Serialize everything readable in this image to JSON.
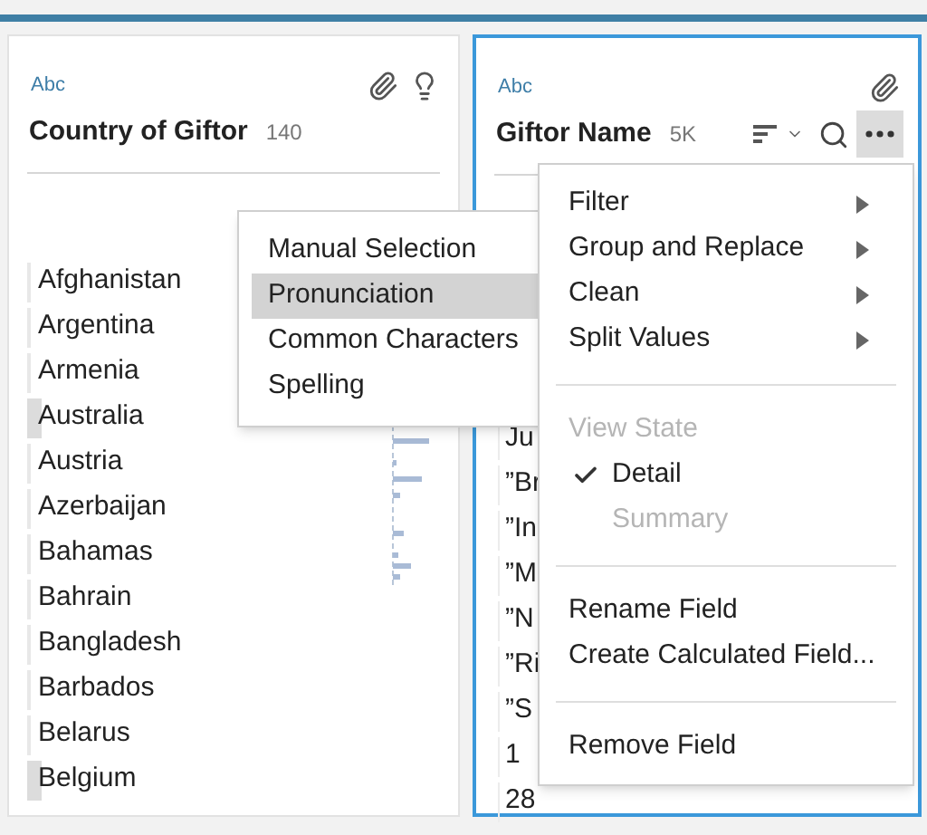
{
  "cards": [
    {
      "type_label": "Abc",
      "title": "Country of Giftor",
      "count": "140",
      "focused": false,
      "tools": false,
      "rows": [
        {
          "label": "Afghanistan",
          "highlighted": false
        },
        {
          "label": "Argentina",
          "highlighted": false
        },
        {
          "label": "Armenia",
          "highlighted": false
        },
        {
          "label": "Australia",
          "highlighted": true
        },
        {
          "label": "Austria",
          "highlighted": false
        },
        {
          "label": "Azerbaijan",
          "highlighted": false
        },
        {
          "label": "Bahamas",
          "highlighted": false
        },
        {
          "label": "Bahrain",
          "highlighted": false
        },
        {
          "label": "Bangladesh",
          "highlighted": false
        },
        {
          "label": "Barbados",
          "highlighted": false
        },
        {
          "label": "Belarus",
          "highlighted": false
        },
        {
          "label": "Belgium",
          "highlighted": true
        }
      ]
    },
    {
      "type_label": "Abc",
      "title": "Giftor Name",
      "count": "5K",
      "focused": true,
      "tools": true,
      "rows": [
        {
          "label": "Ju"
        },
        {
          "label": "”Br"
        },
        {
          "label": "”In"
        },
        {
          "label": "”M"
        },
        {
          "label": "”N"
        },
        {
          "label": "”Ri"
        },
        {
          "label": "”S"
        },
        {
          "label": "1"
        },
        {
          "label": "28"
        }
      ]
    }
  ],
  "submenu": {
    "items": [
      {
        "label": "Manual Selection",
        "selected": false
      },
      {
        "label": "Pronunciation",
        "selected": true
      },
      {
        "label": "Common Characters",
        "selected": false
      },
      {
        "label": "Spelling",
        "selected": false
      }
    ]
  },
  "menu": {
    "items": [
      {
        "kind": "submenu",
        "label": "Filter"
      },
      {
        "kind": "submenu",
        "label": "Group and Replace"
      },
      {
        "kind": "submenu",
        "label": "Clean"
      },
      {
        "kind": "submenu",
        "label": "Split Values"
      },
      {
        "kind": "divider"
      },
      {
        "kind": "header",
        "label": "View State"
      },
      {
        "kind": "check",
        "label": "Detail",
        "checked": true,
        "disabled": false
      },
      {
        "kind": "check",
        "label": "Summary",
        "checked": false,
        "disabled": true
      },
      {
        "kind": "divider"
      },
      {
        "kind": "action",
        "label": "Rename Field"
      },
      {
        "kind": "action",
        "label": "Create Calculated Field..."
      },
      {
        "kind": "divider"
      },
      {
        "kind": "action",
        "label": "Remove Field"
      }
    ]
  }
}
